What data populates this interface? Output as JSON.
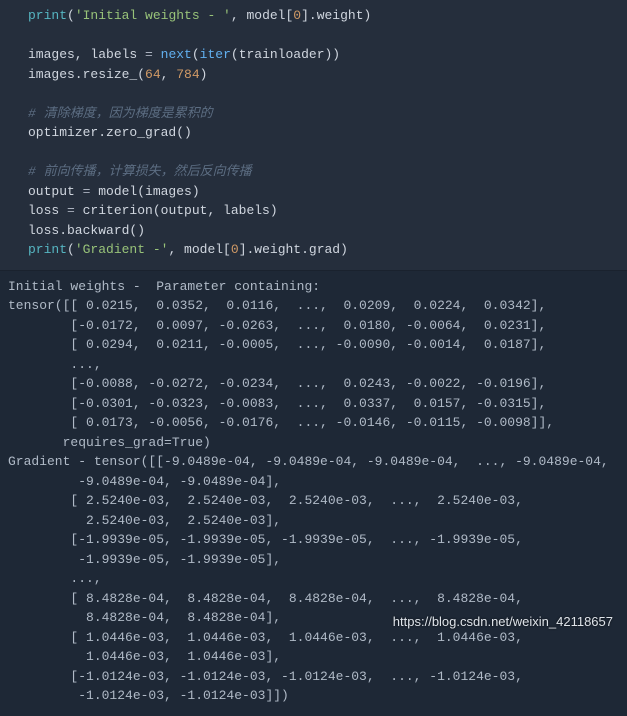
{
  "code": {
    "l1_print": "print",
    "l1_str": "'Initial weights - '",
    "l1_rest_a": ", model[",
    "l1_idx": "0",
    "l1_rest_b": "].weight)",
    "l3_a": "images, labels ",
    "l3_eq": "= ",
    "l3_next": "next",
    "l3_b": "(",
    "l3_iter": "iter",
    "l3_c": "(trainloader))",
    "l4_a": "images.resize_(",
    "l4_n1": "64",
    "l4_comma": ", ",
    "l4_n2": "784",
    "l4_close": ")",
    "l6_comment": "# 清除梯度，因为梯度是累积的",
    "l7": "optimizer.zero_grad()",
    "l9_comment": "# 前向传播，计算损失，然后反向传播",
    "l10_a": "output ",
    "l10_eq": "= ",
    "l10_b": "model(images)",
    "l11_a": "loss ",
    "l11_eq": "= ",
    "l11_b": "criterion(output, labels)",
    "l12": "loss.backward()",
    "l13_print": "print",
    "l13_str": "'Gradient -'",
    "l13_rest_a": ", model[",
    "l13_idx": "0",
    "l13_rest_b": "].weight.grad)"
  },
  "output": {
    "l1": "Initial weights -  Parameter containing:",
    "l2": "tensor([[ 0.0215,  0.0352,  0.0116,  ...,  0.0209,  0.0224,  0.0342],",
    "l3": "        [-0.0172,  0.0097, -0.0263,  ...,  0.0180, -0.0064,  0.0231],",
    "l4": "        [ 0.0294,  0.0211, -0.0005,  ..., -0.0090, -0.0014,  0.0187],",
    "l5": "        ...,",
    "l6": "        [-0.0088, -0.0272, -0.0234,  ...,  0.0243, -0.0022, -0.0196],",
    "l7": "        [-0.0301, -0.0323, -0.0083,  ...,  0.0337,  0.0157, -0.0315],",
    "l8": "        [ 0.0173, -0.0056, -0.0176,  ..., -0.0146, -0.0115, -0.0098]],",
    "l9": "       requires_grad=True)",
    "l10": "Gradient - tensor([[-9.0489e-04, -9.0489e-04, -9.0489e-04,  ..., -9.0489e-04,",
    "l11": "         -9.0489e-04, -9.0489e-04],",
    "l12": "        [ 2.5240e-03,  2.5240e-03,  2.5240e-03,  ...,  2.5240e-03,",
    "l13": "          2.5240e-03,  2.5240e-03],",
    "l14": "        [-1.9939e-05, -1.9939e-05, -1.9939e-05,  ..., -1.9939e-05,",
    "l15": "         -1.9939e-05, -1.9939e-05],",
    "l16": "        ...,",
    "l17": "        [ 8.4828e-04,  8.4828e-04,  8.4828e-04,  ...,  8.4828e-04,",
    "l18": "          8.4828e-04,  8.4828e-04],",
    "l19": "        [ 1.0446e-03,  1.0446e-03,  1.0446e-03,  ...,  1.0446e-03,",
    "l20": "          1.0446e-03,  1.0446e-03],",
    "l21": "        [-1.0124e-03, -1.0124e-03, -1.0124e-03,  ..., -1.0124e-03,",
    "l22": "         -1.0124e-03, -1.0124e-03]])"
  },
  "watermark": "https://blog.csdn.net/weixin_42118657"
}
